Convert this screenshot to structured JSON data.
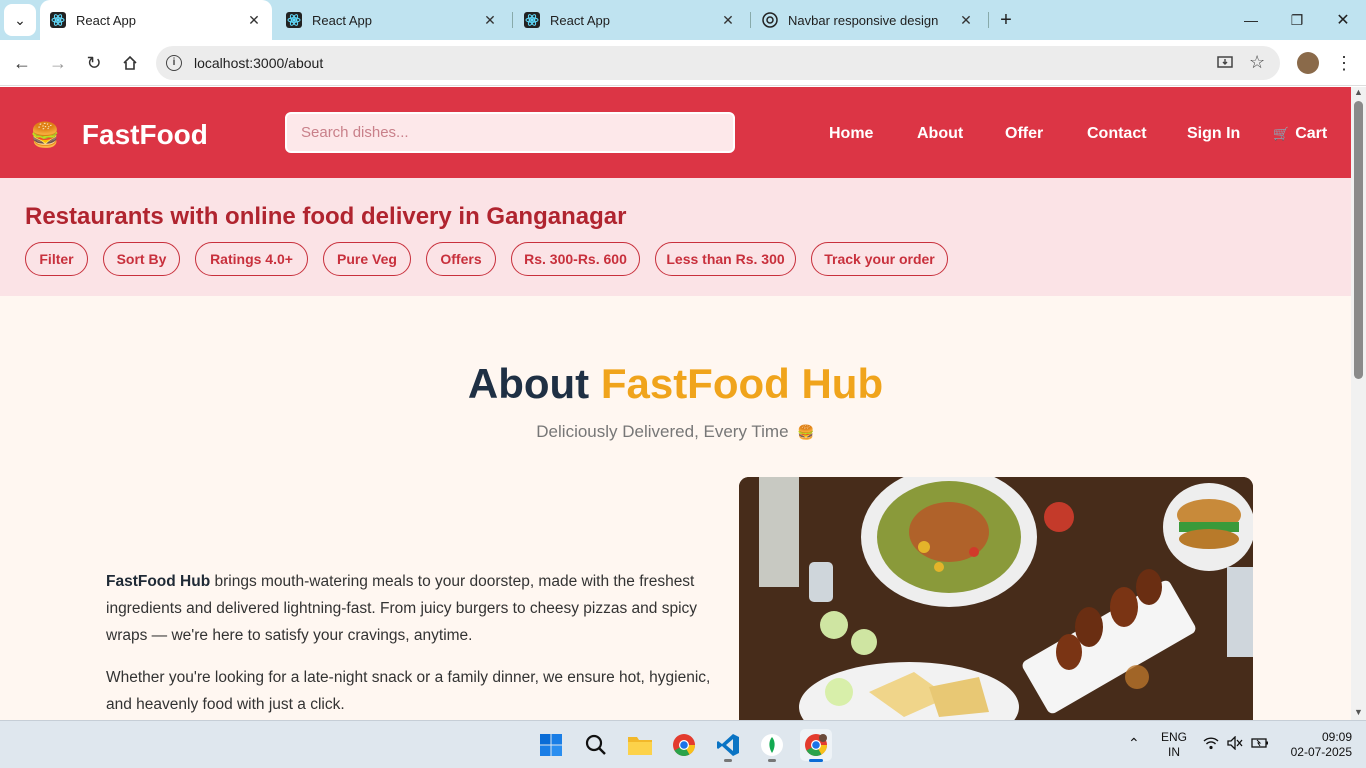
{
  "browser": {
    "tabs": [
      {
        "title": "React App",
        "icon": "react-icon",
        "active": true
      },
      {
        "title": "React App",
        "icon": "react-icon",
        "active": false
      },
      {
        "title": "React App",
        "icon": "react-icon",
        "active": false
      },
      {
        "title": "Navbar responsive design",
        "icon": "openai-icon",
        "active": false
      }
    ],
    "url": "localhost:3000/about"
  },
  "navbar": {
    "brand": "FastFood",
    "brand_icon": "burger-icon",
    "search_placeholder": "Search dishes...",
    "links": [
      "Home",
      "About",
      "Offer",
      "Contact",
      "Sign In"
    ],
    "cart_label": "Cart",
    "cart_icon": "cart-icon"
  },
  "filterbar": {
    "heading": "Restaurants with online food delivery in Ganganagar",
    "chips": [
      "Filter",
      "Sort By",
      "Ratings 4.0+",
      "Pure Veg",
      "Offers",
      "Rs. 300-Rs. 600",
      "Less than Rs. 300",
      "Track your order"
    ]
  },
  "about": {
    "title_prefix": "About",
    "title_highlight": "FastFood Hub",
    "tagline": "Deliciously Delivered, Every Time",
    "tagline_emoji": "🍔",
    "para1_bold": "FastFood Hub",
    "para1_rest": " brings mouth-watering meals to your doorstep, made with the freshest ingredients and delivered lightning-fast. From juicy burgers to cheesy pizzas and spicy wraps — we're here to satisfy your cravings, anytime.",
    "para2": "Whether you're looking for a late-night snack or a family dinner, we ensure hot, hygienic, and heavenly food with just a click."
  },
  "taskbar": {
    "lang_top": "ENG",
    "lang_bottom": "IN",
    "time": "09:09",
    "date": "02-07-2025"
  },
  "colors": {
    "navbar": "#dc3545",
    "filterbar": "#fbe3e6",
    "accent": "#f0a41c",
    "page_bg": "#fff7f1"
  }
}
